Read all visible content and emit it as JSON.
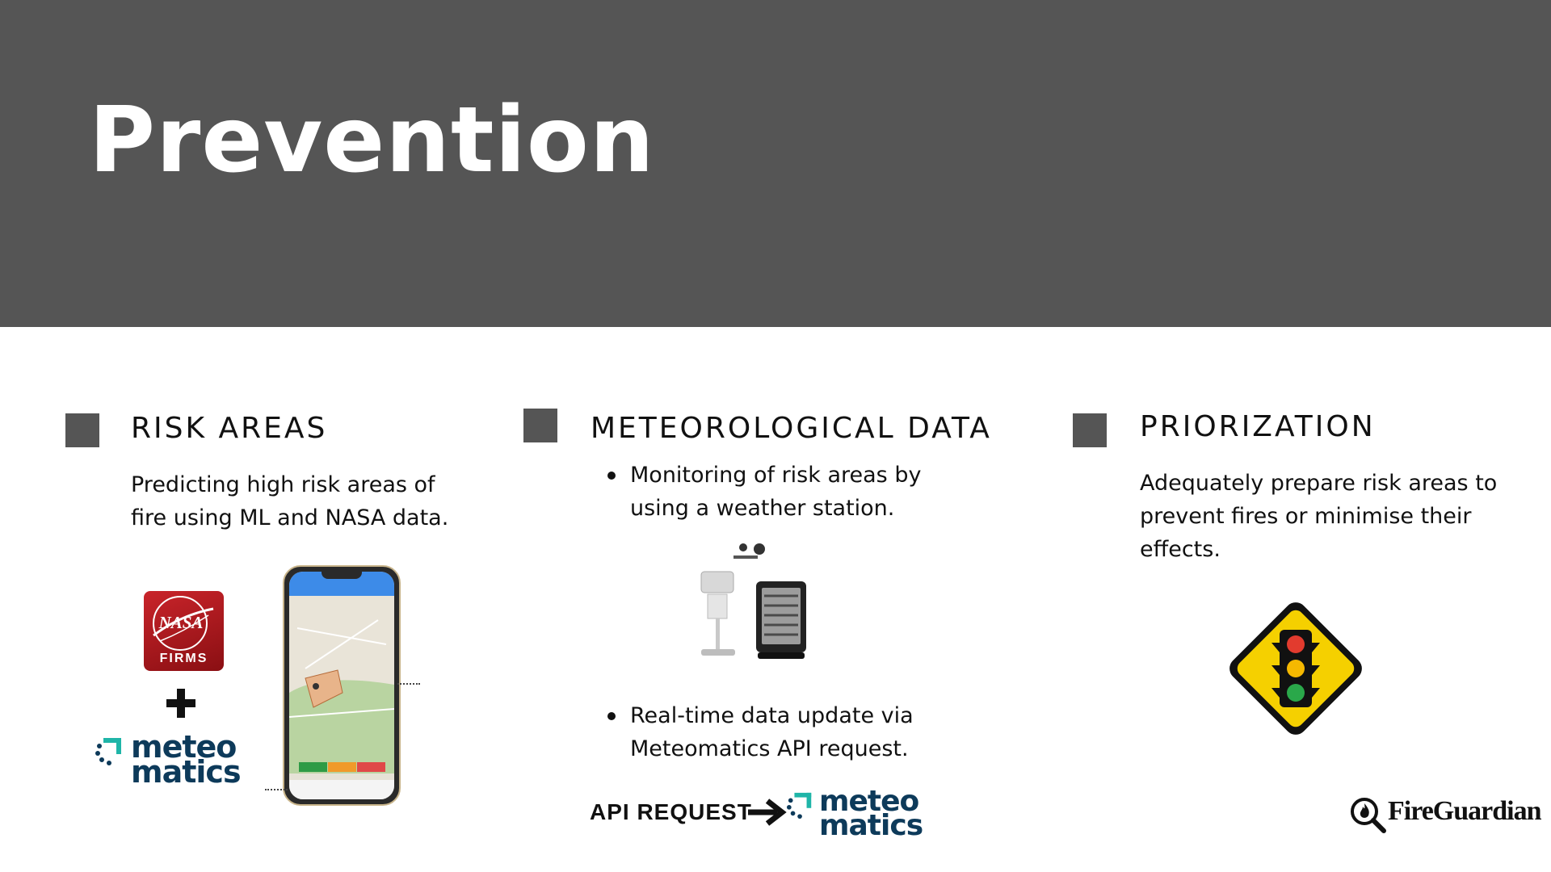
{
  "header": {
    "title": "Prevention",
    "background": "#555555"
  },
  "risk_areas": {
    "title": "RISK AREAS",
    "description_lines": [
      "Predicting high risk areas of",
      "fire using ML and NASA data."
    ],
    "nasa_logo_text": "NASA",
    "nasa_logo_subtext": "FIRMS",
    "plus_icon": "plus-icon",
    "meteo_logo": [
      "meteo",
      "matics"
    ]
  },
  "meteorological_data": {
    "title": "METEOROLOGICAL DATA",
    "bullet1_lines": [
      "Monitoring of risk areas by",
      "using a weather station."
    ],
    "bullet2_lines": [
      "Real-time data update via",
      "Meteomatics API request."
    ],
    "api_label": "API REQUEST",
    "meteo_logo": [
      "meteo",
      "matics"
    ]
  },
  "priorization": {
    "title": "PRIORIZATION",
    "description_lines": [
      "Adequately prepare risk areas to",
      "prevent fires or minimise their",
      "effects."
    ]
  },
  "brand": {
    "name": "FireGuardian"
  },
  "colors": {
    "accent_square": "#555555",
    "meteo_teal": "#1fb5a8",
    "meteo_navy": "#0d3a5a",
    "nasa_red": "#b3141b",
    "sign_yellow": "#f5d000"
  }
}
